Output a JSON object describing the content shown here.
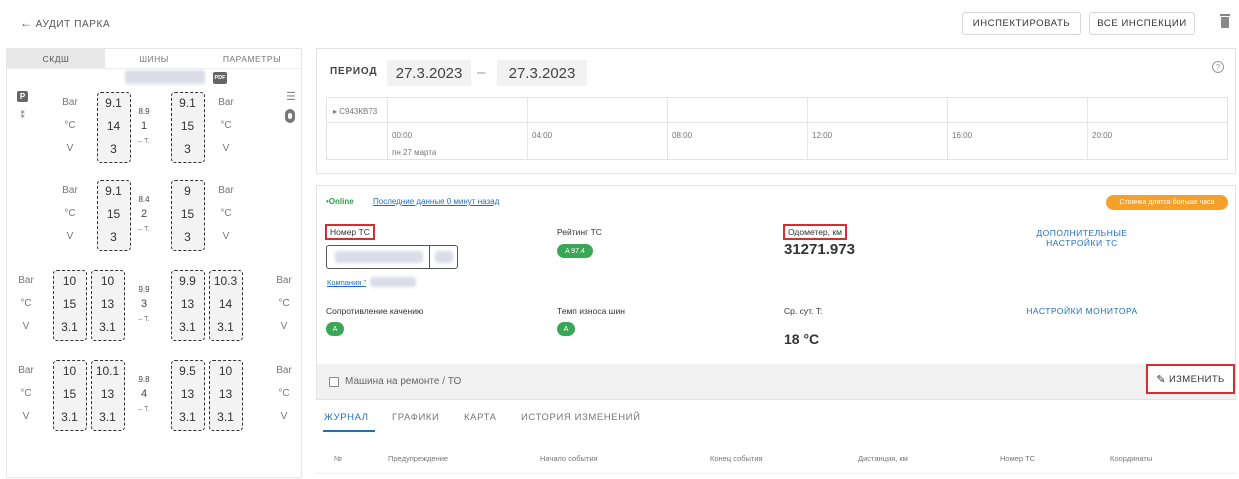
{
  "topbar": {
    "back_label": "АУДИТ ПАРКА",
    "inspect_label": "ИНСПЕКТИРОВАТЬ",
    "all_inspections_label": "ВСЕ ИНСПЕКЦИИ"
  },
  "left": {
    "tabs": [
      "СКДШ",
      "ШИНЫ",
      "ПАРАМЕТРЫ"
    ],
    "pdf_label": "PDF",
    "p_label": "P",
    "units": {
      "pressure": "Bar",
      "temp": "°C",
      "voltage": "V"
    },
    "axles": [
      {
        "tires_left": [
          {
            "p": "9.1",
            "t": "14",
            "v": "3"
          }
        ],
        "middle": {
          "p": "8.9",
          "t": "1",
          "v": "– T."
        },
        "tires_right": [
          {
            "p": "9.1",
            "t": "15",
            "v": "3"
          }
        ]
      },
      {
        "tires_left": [
          {
            "p": "9.1",
            "t": "15",
            "v": "3"
          }
        ],
        "middle": {
          "p": "8.4",
          "t": "2",
          "v": "– T."
        },
        "tires_right": [
          {
            "p": "9",
            "t": "15",
            "v": "3"
          }
        ]
      },
      {
        "tires_left": [
          {
            "p": "10",
            "t": "15",
            "v": "3.1"
          },
          {
            "p": "10",
            "t": "13",
            "v": "3.1"
          }
        ],
        "middle": {
          "p": "9.9",
          "t": "3",
          "v": "– T."
        },
        "tires_right": [
          {
            "p": "9.9",
            "t": "13",
            "v": "3.1"
          },
          {
            "p": "10.3",
            "t": "14",
            "v": "3.1"
          }
        ]
      },
      {
        "tires_left": [
          {
            "p": "10",
            "t": "15",
            "v": "3.1"
          },
          {
            "p": "10.1",
            "t": "13",
            "v": "3.1"
          }
        ],
        "middle": {
          "p": "9.8",
          "t": "4",
          "v": "– T."
        },
        "tires_right": [
          {
            "p": "9.5",
            "t": "13",
            "v": "3.1"
          },
          {
            "p": "10",
            "t": "13",
            "v": "3.1"
          }
        ]
      }
    ]
  },
  "period": {
    "label": "ПЕРИОД",
    "from": "27.3.2023",
    "separator": "–",
    "to": "27.3.2023",
    "help": "?",
    "timeline": {
      "vehicle": "▸ С943КВ73",
      "ticks": [
        "00:00",
        "04:00",
        "08:00",
        "12:00",
        "16:00",
        "20:00"
      ],
      "day": "пн 27 марта"
    }
  },
  "info": {
    "online": "•Online",
    "last_data": "Последние данные 0 минут назад",
    "alert": "Стоянка длится больше часа",
    "plate_label": "Номер ТС",
    "company_label": "Компания \"",
    "rating_label": "Рейтинг ТС",
    "rating_value": "A 97.4",
    "odometer_label": "Одометер, км",
    "odometer_value": "31271.973",
    "extra_settings": "ДОПОЛНИТЕЛЬНЫЕ НАСТРОЙКИ ТС",
    "rolling_label": "Сопротивление качению",
    "rolling_value": "A",
    "wear_label": "Темп износа шин",
    "wear_value": "A",
    "avg_temp_label": "Ср. сут. T:",
    "avg_temp_value": "18 °C",
    "monitor_settings": "НАСТРОЙКИ МОНИТОРА",
    "repair_label": "Машина на ремонте / ТО",
    "edit_label": "ИЗМЕНИТЬ"
  },
  "bottom_tabs": [
    "ЖУРНАЛ",
    "ГРАФИКИ",
    "КАРТА",
    "ИСТОРИЯ ИЗМЕНЕНИЙ"
  ],
  "table_headers": [
    "№",
    "Предупреждение",
    "Начало события",
    "Конец события",
    "Дистанция, км",
    "Номер ТС",
    "Координаты"
  ]
}
